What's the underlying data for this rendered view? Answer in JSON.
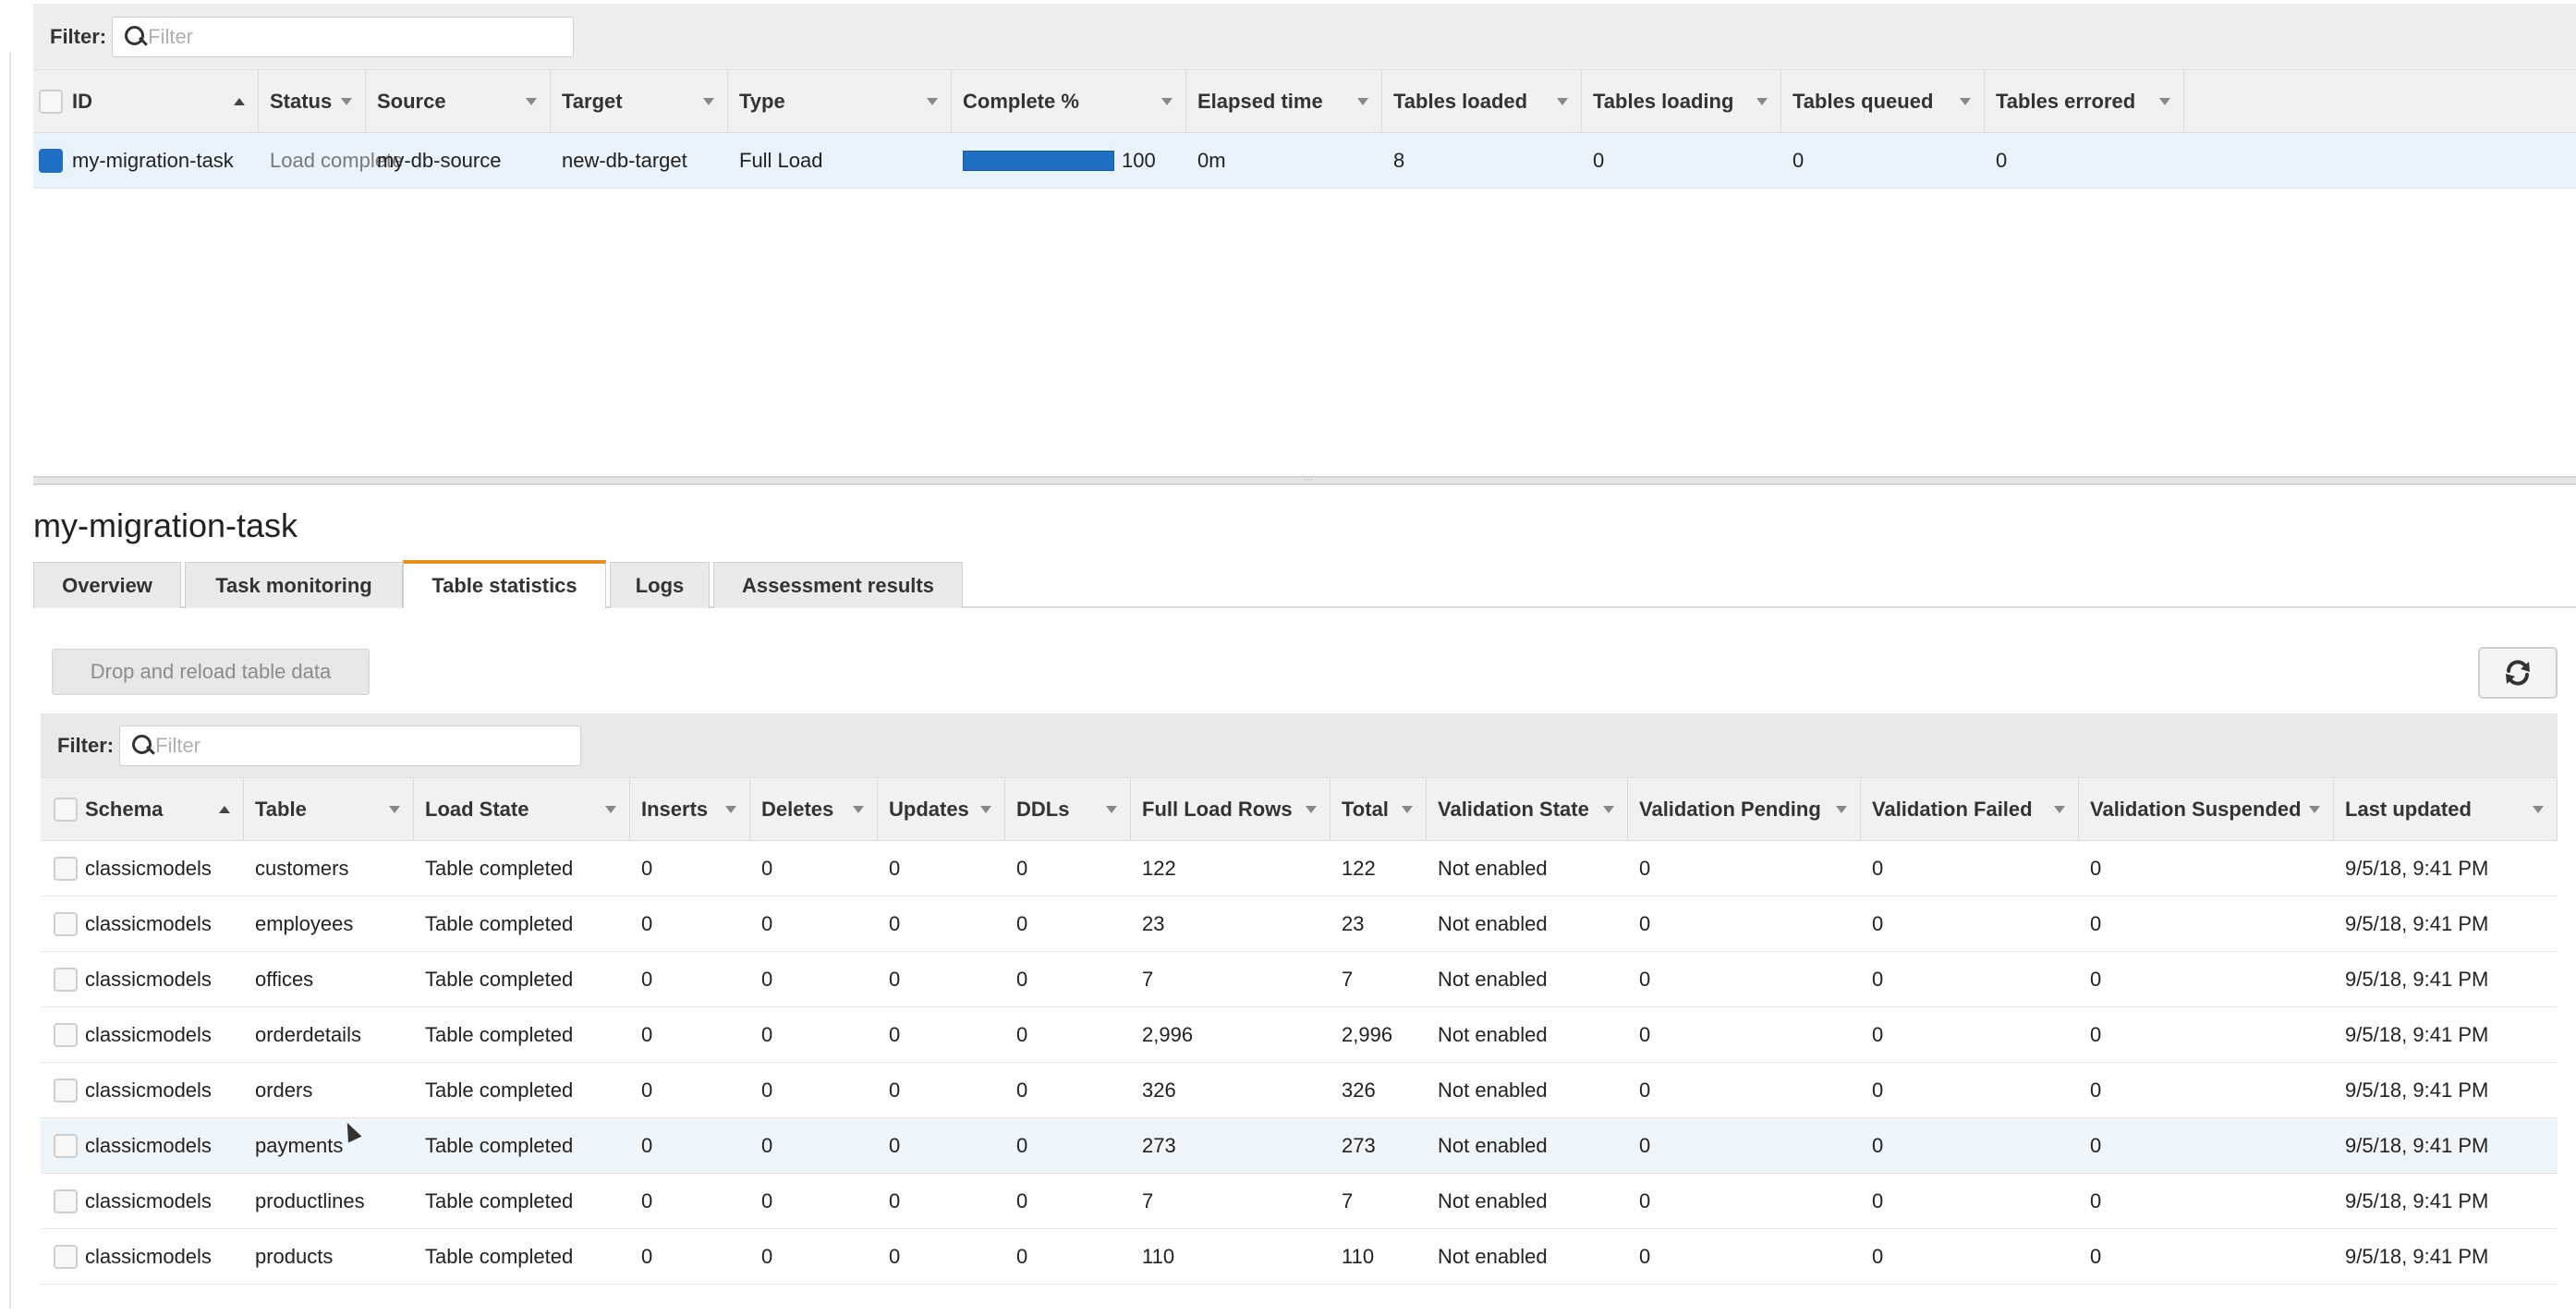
{
  "task_list": {
    "filter_label": "Filter:",
    "filter_placeholder": "Filter",
    "columns": [
      "ID",
      "Status",
      "Source",
      "Target",
      "Type",
      "Complete %",
      "Elapsed time",
      "Tables loaded",
      "Tables loading",
      "Tables queued",
      "Tables errored"
    ],
    "rows": [
      {
        "id": "my-migration-task",
        "status": "Load complete",
        "source": "my-db-source",
        "target": "new-db-target",
        "type": "Full Load",
        "complete_pct": "100",
        "progress_fraction": 1.0,
        "elapsed": "0m",
        "tables_loaded": "8",
        "tables_loading": "0",
        "tables_queued": "0",
        "tables_errored": "0",
        "selected": true
      }
    ]
  },
  "details": {
    "title": "my-migration-task",
    "tabs": [
      "Overview",
      "Task monitoring",
      "Table statistics",
      "Logs",
      "Assessment results"
    ],
    "active_tab": "Table statistics",
    "drop_reload_label": "Drop and reload table data",
    "refresh_icon": "refresh-icon"
  },
  "table_stats": {
    "filter_label": "Filter:",
    "filter_placeholder": "Filter",
    "columns": [
      "Schema",
      "Table",
      "Load State",
      "Inserts",
      "Deletes",
      "Updates",
      "DDLs",
      "Full Load Rows",
      "Total",
      "Validation State",
      "Validation Pending",
      "Validation Failed",
      "Validation Suspended",
      "Last updated"
    ],
    "rows": [
      [
        "classicmodels",
        "customers",
        "Table completed",
        "0",
        "0",
        "0",
        "0",
        "122",
        "122",
        "Not enabled",
        "0",
        "0",
        "0",
        "9/5/18, 9:41 PM"
      ],
      [
        "classicmodels",
        "employees",
        "Table completed",
        "0",
        "0",
        "0",
        "0",
        "23",
        "23",
        "Not enabled",
        "0",
        "0",
        "0",
        "9/5/18, 9:41 PM"
      ],
      [
        "classicmodels",
        "offices",
        "Table completed",
        "0",
        "0",
        "0",
        "0",
        "7",
        "7",
        "Not enabled",
        "0",
        "0",
        "0",
        "9/5/18, 9:41 PM"
      ],
      [
        "classicmodels",
        "orderdetails",
        "Table completed",
        "0",
        "0",
        "0",
        "0",
        "2,996",
        "2,996",
        "Not enabled",
        "0",
        "0",
        "0",
        "9/5/18, 9:41 PM"
      ],
      [
        "classicmodels",
        "orders",
        "Table completed",
        "0",
        "0",
        "0",
        "0",
        "326",
        "326",
        "Not enabled",
        "0",
        "0",
        "0",
        "9/5/18, 9:41 PM"
      ],
      [
        "classicmodels",
        "payments",
        "Table completed",
        "0",
        "0",
        "0",
        "0",
        "273",
        "273",
        "Not enabled",
        "0",
        "0",
        "0",
        "9/5/18, 9:41 PM"
      ],
      [
        "classicmodels",
        "productlines",
        "Table completed",
        "0",
        "0",
        "0",
        "0",
        "7",
        "7",
        "Not enabled",
        "0",
        "0",
        "0",
        "9/5/18, 9:41 PM"
      ],
      [
        "classicmodels",
        "products",
        "Table completed",
        "0",
        "0",
        "0",
        "0",
        "110",
        "110",
        "Not enabled",
        "0",
        "0",
        "0",
        "9/5/18, 9:41 PM"
      ]
    ],
    "hover_row": 5
  },
  "colors": {
    "accent_tab": "#e88f1f",
    "progress": "#1e6fc4",
    "selected_row": "#e9f3fb"
  }
}
